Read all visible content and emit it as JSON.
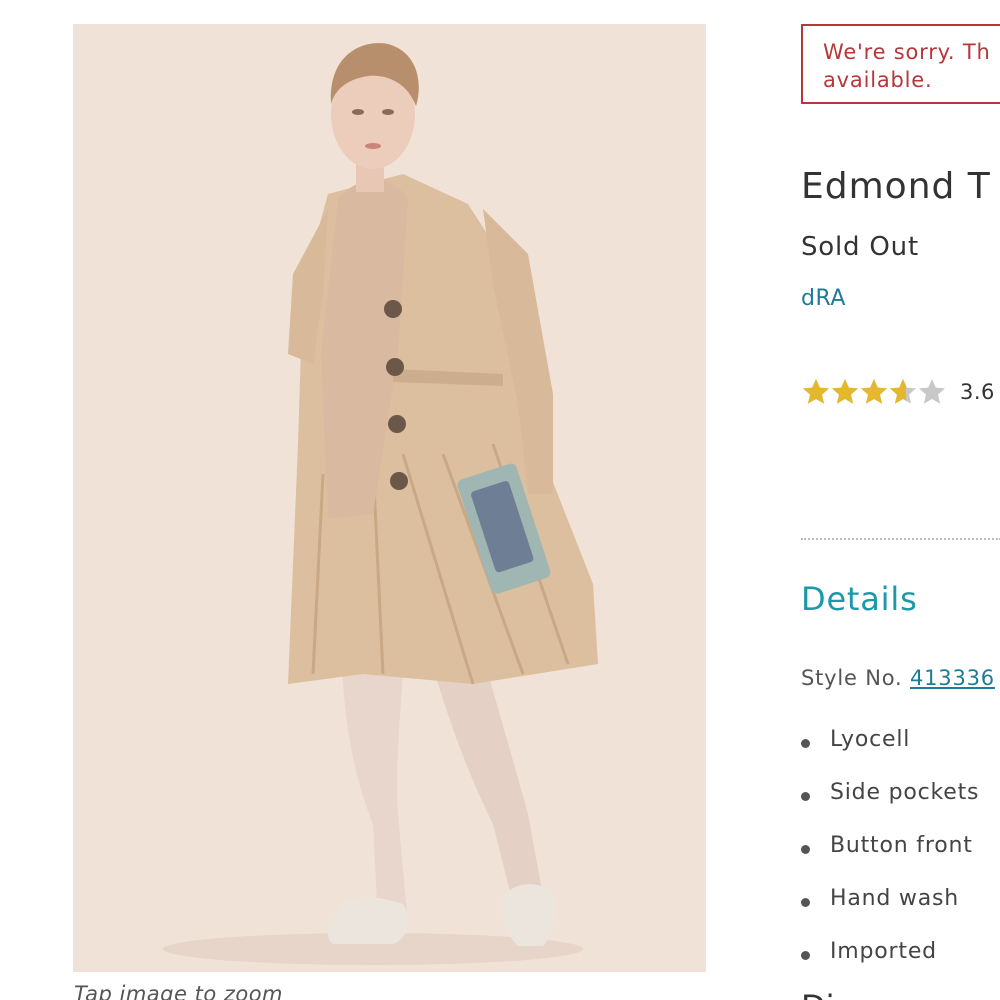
{
  "image": {
    "caption": "Tap image to zoom"
  },
  "alert": {
    "line1": "We're sorry. Th",
    "line2": "available."
  },
  "product": {
    "title": "Edmond T",
    "stock_status": "Sold Out",
    "brand": "dRA",
    "rating_value": "3.6",
    "rating_stars": 3.6
  },
  "details": {
    "heading": "Details",
    "style_label": "Style No.",
    "style_number": "413336",
    "features": [
      "Lyocell",
      "Side pockets",
      "Button front",
      "Hand wash",
      "Imported"
    ],
    "next_heading": "Di"
  },
  "colors": {
    "alert": "#b5373a",
    "link": "#1f7a9a",
    "heading_accent": "#1a9aa8",
    "star_filled": "#e5b72c",
    "star_empty": "#c8c8c8"
  }
}
